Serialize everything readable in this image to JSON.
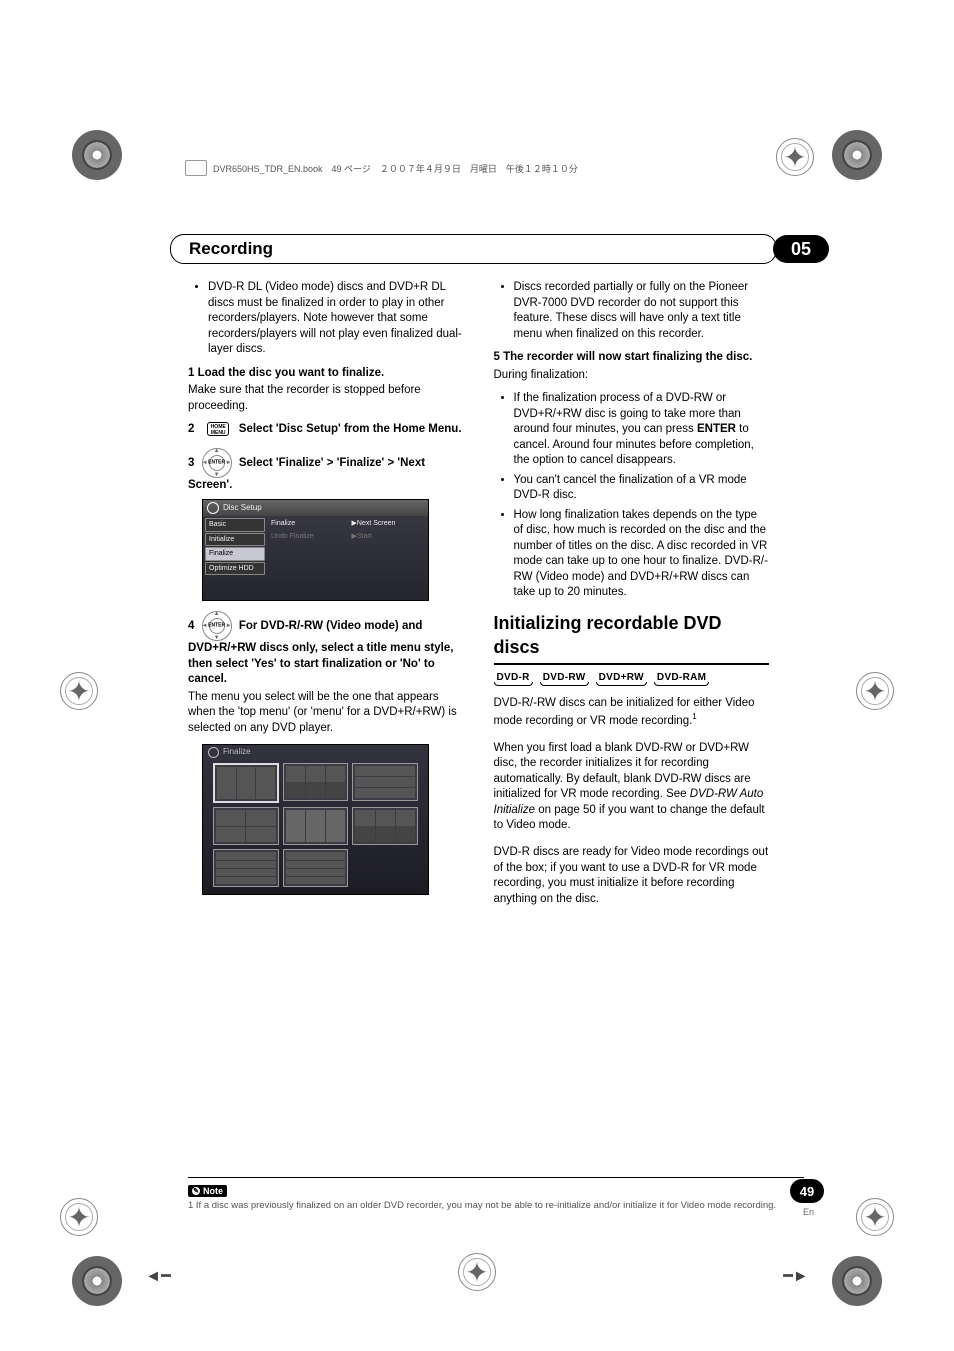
{
  "header": {
    "book_info": "DVR650HS_TDR_EN.book　49 ページ　２００７年４月９日　月曜日　午後１２時１０分"
  },
  "chapter": {
    "title": "Recording",
    "number": "05"
  },
  "col1": {
    "bullet1": "DVD-R DL (Video mode) discs and DVD+R DL discs must be finalized in order to play in other recorders/players. Note however that some recorders/players will not play even finalized dual-layer discs.",
    "step1_head": "1    Load the disc you want to finalize.",
    "step1_body": "Make sure that the recorder is stopped before proceeding.",
    "step2_head_after": "Select 'Disc Setup' from the Home Menu.",
    "step2_num": "2",
    "step3_num": "3",
    "step3_head_after": " Select 'Finalize' > 'Finalize' > 'Next Screen'.",
    "disc_setup": {
      "title": "Disc Setup",
      "left": [
        "Basic",
        "Initialize",
        "Finalize",
        "Optimize HDD"
      ],
      "mid": [
        "Finalize",
        "Undo Finalize"
      ],
      "right": [
        "Next Screen",
        "Start"
      ]
    },
    "step4_num": "4",
    "step4_head_after": " For DVD-R/-RW (Video mode) and DVD+R/+RW discs only, select a title menu style, then select 'Yes' to start finalization or 'No' to cancel.",
    "step4_body": "The menu you select will be the one that appears when the 'top menu' (or 'menu' for a DVD+R/+RW) is selected on any DVD player.",
    "finalize_title": "Finalize"
  },
  "col2": {
    "bullet1": "Discs recorded partially or fully on the Pioneer DVR-7000 DVD recorder do not support this feature. These discs will have only a text title menu when finalized on this recorder.",
    "step5_head": "5    The recorder will now start finalizing the disc.",
    "step5_body": "During finalization:",
    "sub_bullets": [
      "If the finalization process of a DVD-RW or DVD+R/+RW disc is going to take more than around four minutes, you can press ENTER to cancel. Around four minutes before completion, the option to cancel disappears.",
      "You can't cancel the finalization of a VR mode DVD-R disc.",
      "How long finalization takes depends on the type of disc, how much is recorded on the disc and the number of titles on the disc. A disc recorded in VR mode can take up to one hour to finalize. DVD-R/-RW (Video mode) and DVD+R/+RW discs can take up to 20 minutes."
    ],
    "section_title": "Initializing recordable DVD discs",
    "disc_types": [
      "DVD-R",
      "DVD-RW",
      "DVD+RW",
      "DVD-RAM"
    ],
    "para1a": "DVD-R/-RW discs can be initialized for either Video mode recording or VR mode recording.",
    "para2a": "When you first load a blank DVD-RW or DVD+RW disc, the recorder initializes it for recording automatically. By default, blank DVD-RW discs are initialized for VR mode recording. See ",
    "para2b_italic": "DVD-RW Auto Initialize",
    "para2c": " on page 50 if you want to change the default to Video mode.",
    "para3": "DVD-R discs are ready for Video mode recordings out of the box; if you want to use a DVD-R for VR mode recording, you must initialize it before recording anything on the disc."
  },
  "note": {
    "label": "Note",
    "text": "1 If a disc was previously finalized on an older DVD recorder, you may not be able to re-initialize and/or initialize it for Video mode recording."
  },
  "footer": {
    "page": "49",
    "lang": "En"
  },
  "icons": {
    "homemenu": "HOME\nMENU",
    "enter": "ENTER",
    "arrow_right": "▶"
  }
}
